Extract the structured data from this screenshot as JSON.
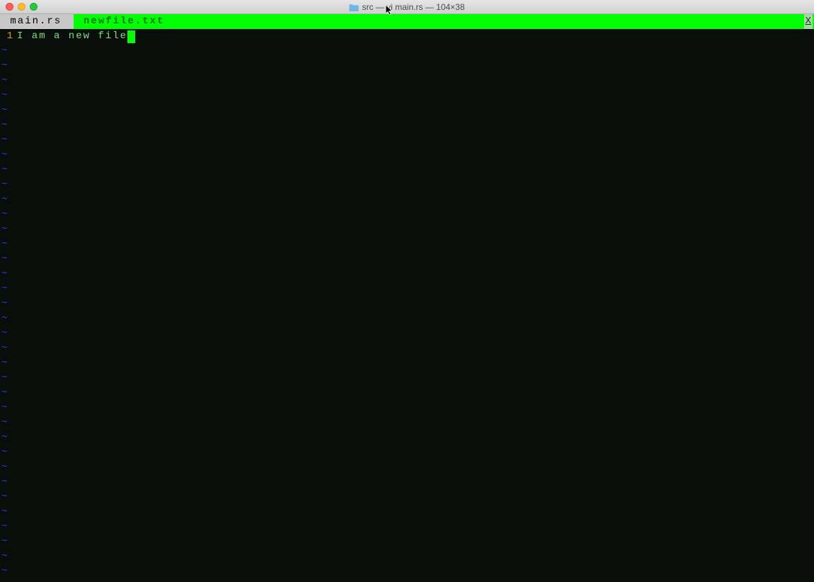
{
  "window": {
    "title": "src — vi main.rs — 104×38"
  },
  "tabs": {
    "inactive": " main.rs ",
    "active": " newfile.txt ",
    "close_label": "X"
  },
  "editor": {
    "line_number": "1",
    "content": "I am a new file",
    "tilde": "~"
  },
  "colors": {
    "tabbar_bg": "#00ff00"
  }
}
